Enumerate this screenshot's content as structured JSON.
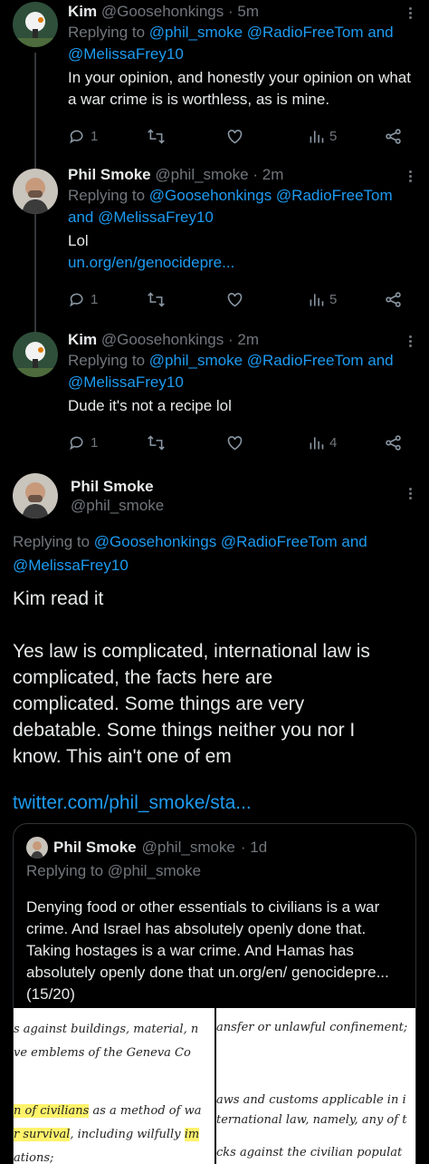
{
  "tweets": [
    {
      "name": "Kim",
      "handle": "@Goosehonkings",
      "time": "· 5m",
      "reply_prefix": "Replying to",
      "reply_mentions": "@phil_smoke @RadioFreeTom and @MelissaFrey10",
      "text": "In your opinion, and honestly your opinion on what a war crime is is worthless, as is mine.",
      "replies": "1",
      "views": "5"
    },
    {
      "name": "Phil Smoke",
      "handle": "@phil_smoke",
      "time": "· 2m",
      "reply_prefix": "Replying to",
      "reply_mentions": "@Goosehonkings @RadioFreeTom and @MelissaFrey10",
      "text": "Lol",
      "link": "un.org/en/genocidepre...",
      "replies": "1",
      "views": "5"
    },
    {
      "name": "Kim",
      "handle": "@Goosehonkings",
      "time": "· 2m",
      "reply_prefix": "Replying to",
      "reply_mentions": "@phil_smoke @RadioFreeTom and @MelissaFrey10",
      "text": "Dude it's not a recipe lol",
      "replies": "1",
      "views": "4"
    }
  ],
  "main": {
    "name": "Phil Smoke",
    "handle": "@phil_smoke",
    "reply_prefix": "Replying to",
    "reply_mentions": "@Goosehonkings @RadioFreeTom and @MelissaFrey10",
    "text_1": "Kim read it",
    "text_2": "Yes law is complicated, international law is complicated, the facts here are complicated. Some things are very debatable. Some things neither you nor I know. This ain't one of em",
    "link": "twitter.com/phil_smoke/sta..."
  },
  "quote": {
    "name": "Phil Smoke",
    "handle": "@phil_smoke",
    "time": "· 1d",
    "reply": "Replying to @phil_smoke",
    "text": "Denying food or other essentials to civilians is a war crime. And Israel has absolutely openly done that. Taking hostages is a war crime. And Hamas has absolutely openly done that un.org/en/ genocidepre... (15/20)",
    "image_left": {
      "line1": "s against buildings, material, n",
      "line2": "ve emblems of the Geneva Co",
      "line3_hl": "n of civilians",
      "line3_rest": " as a method of wa",
      "line4_hl": "r survival",
      "line4_mid": ", including wilfully ",
      "line4_hl2": "im",
      "line5": "ations;"
    },
    "image_right": {
      "line1": "ansfer or unlawful confinement;",
      "line2": "aws and customs applicable in i",
      "line3": "ternational law, namely, any of t",
      "line4": "cks against the civilian populat"
    }
  },
  "icons": [
    "reply-icon",
    "retweet-icon",
    "like-icon",
    "views-icon",
    "share-icon",
    "more-icon"
  ],
  "colors": {
    "background": "#000000",
    "text": "#e7e9ea",
    "muted": "#71767b",
    "link": "#1d9bf0",
    "highlight": "#fff36b"
  }
}
